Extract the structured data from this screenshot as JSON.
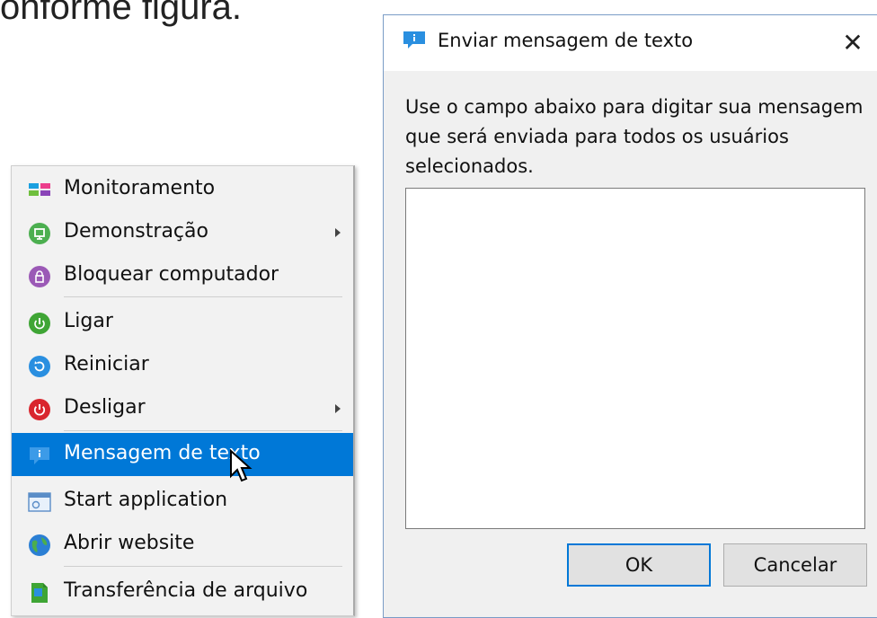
{
  "document": {
    "text": "conforme figura."
  },
  "context_menu": {
    "items": [
      {
        "label": "Monitoramento",
        "icon": "monitor-grid-icon"
      },
      {
        "label": "Demonstração",
        "icon": "presentation-icon",
        "submenu": true
      },
      {
        "label": "Bloquear computador",
        "icon": "lock-icon"
      },
      {
        "label": "Ligar",
        "icon": "power-on-icon"
      },
      {
        "label": "Reiniciar",
        "icon": "restart-icon"
      },
      {
        "label": "Desligar",
        "icon": "power-off-icon",
        "submenu": true
      },
      {
        "label": "Mensagem de texto",
        "icon": "message-icon",
        "active": true
      },
      {
        "label": "Start application",
        "icon": "application-icon"
      },
      {
        "label": "Abrir website",
        "icon": "globe-icon"
      },
      {
        "label": "Transferência de arquivo",
        "icon": "file-transfer-icon"
      }
    ]
  },
  "dialog": {
    "title": "Enviar mensagem de texto",
    "close_label": "✕",
    "description": "Use o campo abaixo para digitar sua mensagem que será enviada para todos os usuários selecionados.",
    "message_value": "",
    "ok_label": "OK",
    "cancel_label": "Cancelar"
  },
  "colors": {
    "accent": "#0078d7",
    "menu_bg": "#f2f2f2",
    "dialog_bg": "#f0f0f0"
  }
}
